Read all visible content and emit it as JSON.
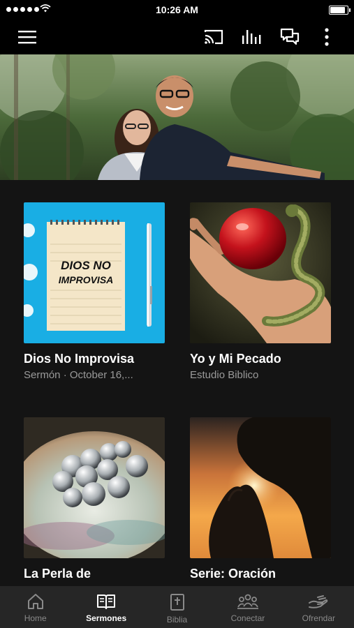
{
  "status": {
    "time": "10:26 AM",
    "battery_level": 0.95
  },
  "nav": {
    "icons": [
      "menu-icon",
      "cast-icon",
      "audio-bars-icon",
      "chat-icon",
      "more-vertical-icon"
    ]
  },
  "cards": [
    {
      "title": "Dios No Improvisa",
      "subtitle": "Sermón · October 16,...",
      "thumb_text_1": "DIOS NO",
      "thumb_text_2": "IMPROVISA"
    },
    {
      "title": "Yo y Mi Pecado",
      "subtitle": "Estudio Biblico"
    },
    {
      "title": "La Perla de",
      "subtitle": ""
    },
    {
      "title": "Serie: Oración",
      "subtitle": ""
    }
  ],
  "tabs": [
    {
      "label": "Home",
      "icon": "home-icon",
      "active": false
    },
    {
      "label": "Sermones",
      "icon": "book-open-icon",
      "active": true
    },
    {
      "label": "Biblia",
      "icon": "bible-icon",
      "active": false
    },
    {
      "label": "Conectar",
      "icon": "people-icon",
      "active": false
    },
    {
      "label": "Ofrendar",
      "icon": "giving-hand-icon",
      "active": false
    }
  ],
  "colors": {
    "background": "#141414",
    "top_bar": "#000000",
    "tab_bar": "#262626",
    "active_tab": "#ffffff",
    "inactive_tab": "#8a8a8a",
    "subtitle": "#9a9a9a"
  }
}
